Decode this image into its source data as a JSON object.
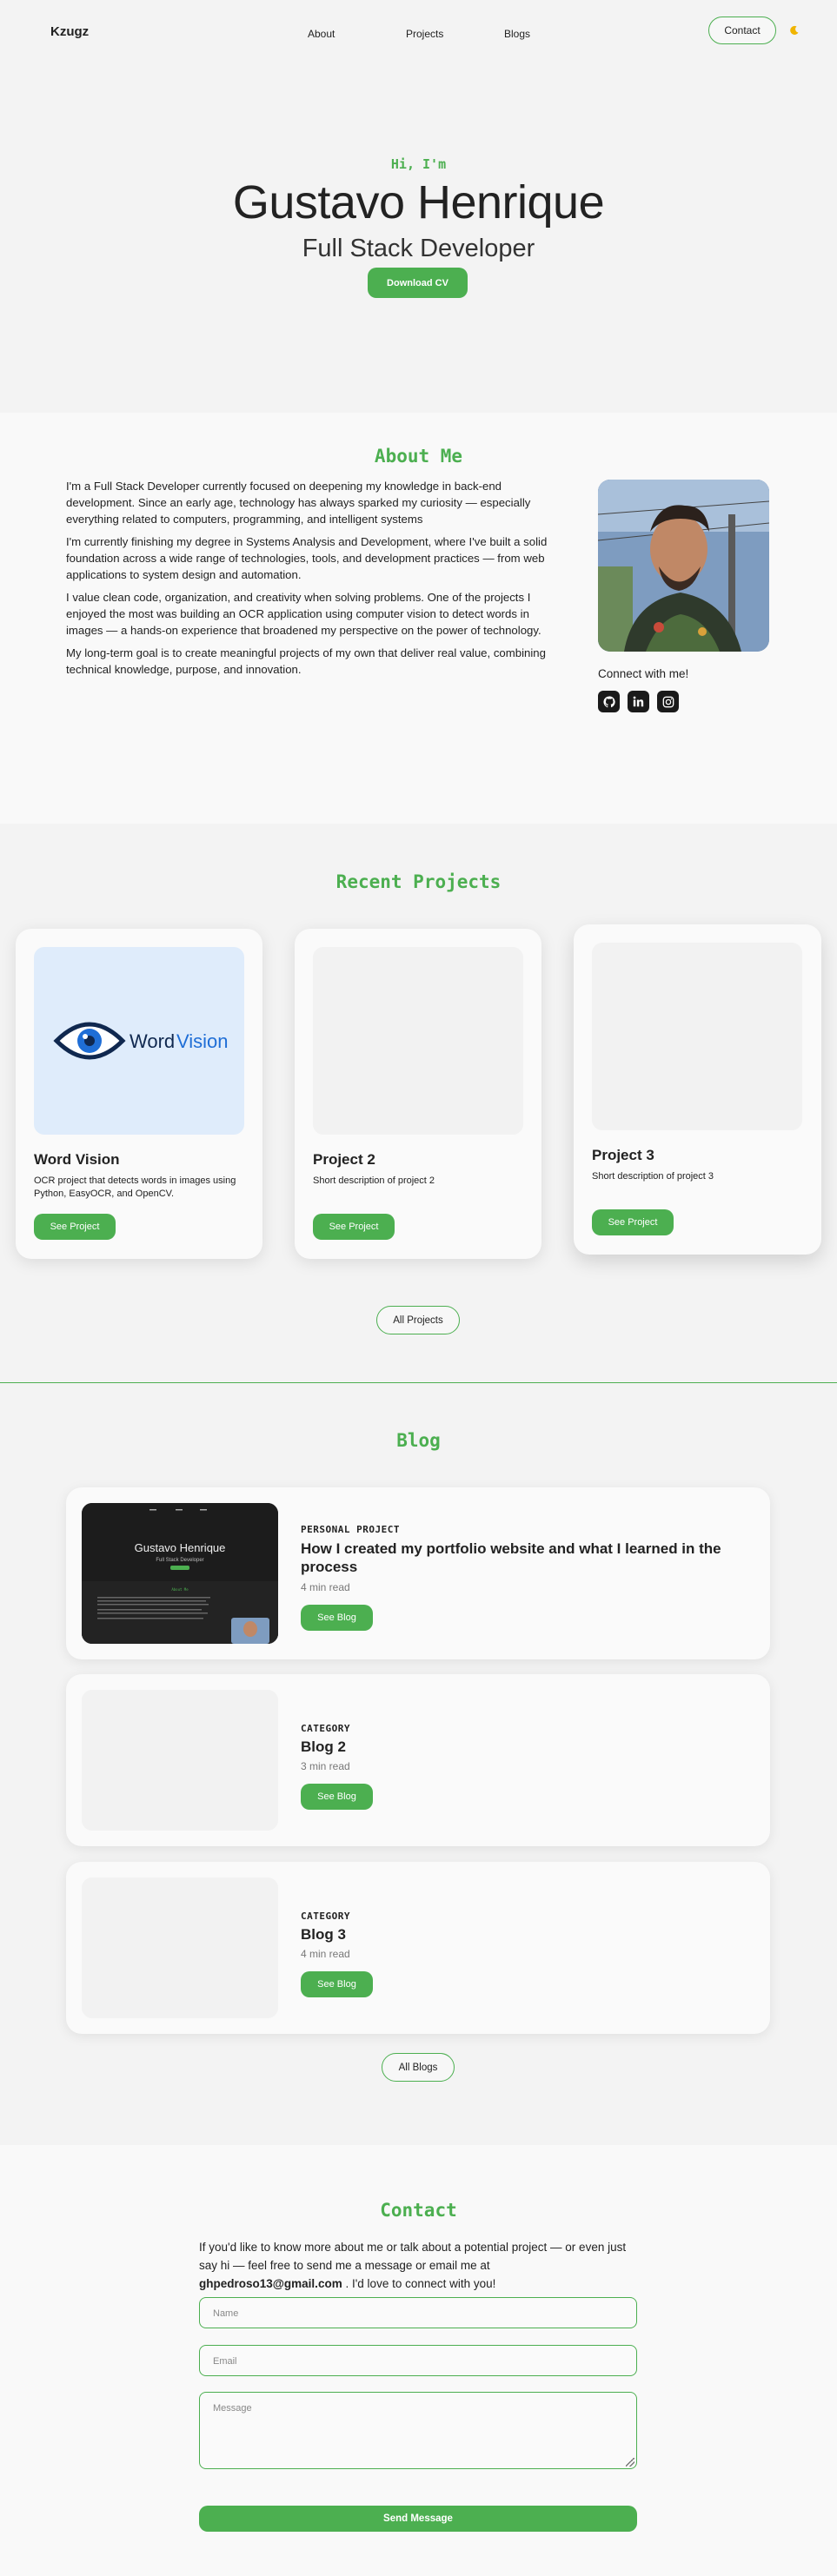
{
  "nav": {
    "logo": "Kzugz",
    "links": [
      "About",
      "Projects",
      "Blogs"
    ],
    "contact_label": "Contact",
    "theme_icon": "moon-icon"
  },
  "hero": {
    "greeting": "Hi, I'm",
    "name": "Gustavo Henrique",
    "role": "Full Stack Developer",
    "cv_label": "Download CV"
  },
  "about": {
    "title": "About Me",
    "paragraphs": [
      "I'm a Full Stack Developer currently focused on deepening my knowledge in back-end development. Since an early age, technology has always sparked my curiosity — especially everything related to computers, programming, and intelligent systems",
      "I'm currently finishing my degree in Systems Analysis and Development, where I've built a solid foundation across a wide range of technologies, tools, and development practices — from web applications to system design and automation.",
      "I value clean code, organization, and creativity when solving problems. One of the projects I enjoyed the most was building an OCR application using computer vision to detect words in images — a hands-on experience that broadened my perspective on the power of technology.",
      "My long-term goal is to create meaningful projects of my own that deliver real value, combining technical knowledge, purpose, and innovation."
    ],
    "connect_label": "Connect with me!",
    "socials": [
      "github-icon",
      "linkedin-icon",
      "instagram-icon"
    ]
  },
  "projects": {
    "title": "Recent Projects",
    "items": [
      {
        "title": "Word Vision",
        "description": "OCR project that detects words in images using Python, EasyOCR, and OpenCV.",
        "button": "See Project",
        "logo_word": "Word",
        "logo_word2": "Vision"
      },
      {
        "title": "Project 2",
        "description": "Short description of project 2",
        "button": "See Project"
      },
      {
        "title": "Project 3",
        "description": "Short description of project 3",
        "button": "See Project"
      }
    ],
    "all_label": "All Projects"
  },
  "blog": {
    "title": "Blog",
    "items": [
      {
        "category": "PERSONAL PROJECT",
        "title": "How I created my portfolio website and what I learned in the process",
        "read_time": "4 min read",
        "button": "See Blog",
        "thumb": {
          "name": "Gustavo Henrique",
          "role": "Full Stack Developer",
          "about": "About Me"
        }
      },
      {
        "category": "CATEGORY",
        "title": "Blog 2",
        "read_time": "3 min read",
        "button": "See Blog"
      },
      {
        "category": "CATEGORY",
        "title": "Blog 3",
        "read_time": "4 min read",
        "button": "See Blog"
      }
    ],
    "all_label": "All Blogs"
  },
  "contact": {
    "title": "Contact",
    "intro": "If you'd like to know more about me or talk about a potential project — or even just say hi — feel free to send me a message or email me at",
    "email": "ghpedroso13@gmail.com",
    "outro": ". I'd love to connect with you!",
    "name_placeholder": "Name",
    "email_placeholder": "Email",
    "message_placeholder": "Message",
    "send_label": "Send Message"
  },
  "colors": {
    "accent": "#4caf50",
    "text": "#222222",
    "bg_light": "#f3f3f3",
    "bg_alt": "#f9f9f9"
  }
}
